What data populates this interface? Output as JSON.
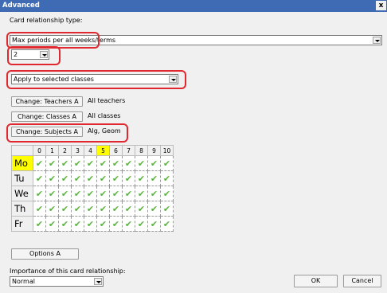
{
  "window": {
    "title": "Advanced",
    "close_label": "x"
  },
  "relationship": {
    "label": "Card relationship type:",
    "type_value": "Max periods per all weeks/terms",
    "count_value": "2",
    "apply_value": "Apply to selected classes"
  },
  "filters": [
    {
      "button": "Change: Teachers A",
      "value": "All teachers"
    },
    {
      "button": "Change: Classes A",
      "value": "All classes"
    },
    {
      "button": "Change: Subjects A",
      "value": "Alg, Geom"
    }
  ],
  "grid": {
    "periods": [
      "0",
      "1",
      "2",
      "3",
      "4",
      "5",
      "6",
      "7",
      "8",
      "9",
      "10"
    ],
    "highlighted_period": "5",
    "days": [
      "Mo",
      "Tu",
      "We",
      "Th",
      "Fr"
    ],
    "highlighted_day": "Mo",
    "cell_symbol": "✔",
    "cell_icon": "check-icon",
    "check_color": "#59b53a"
  },
  "options_button": "Options A",
  "importance": {
    "label": "Importance of this card relationship:",
    "value": "Normal"
  },
  "buttons": {
    "ok": "OK",
    "cancel": "Cancel"
  },
  "colors": {
    "titlebar": "#3e6bb4",
    "highlight": "#ffff00",
    "outline": "#e0282e"
  }
}
